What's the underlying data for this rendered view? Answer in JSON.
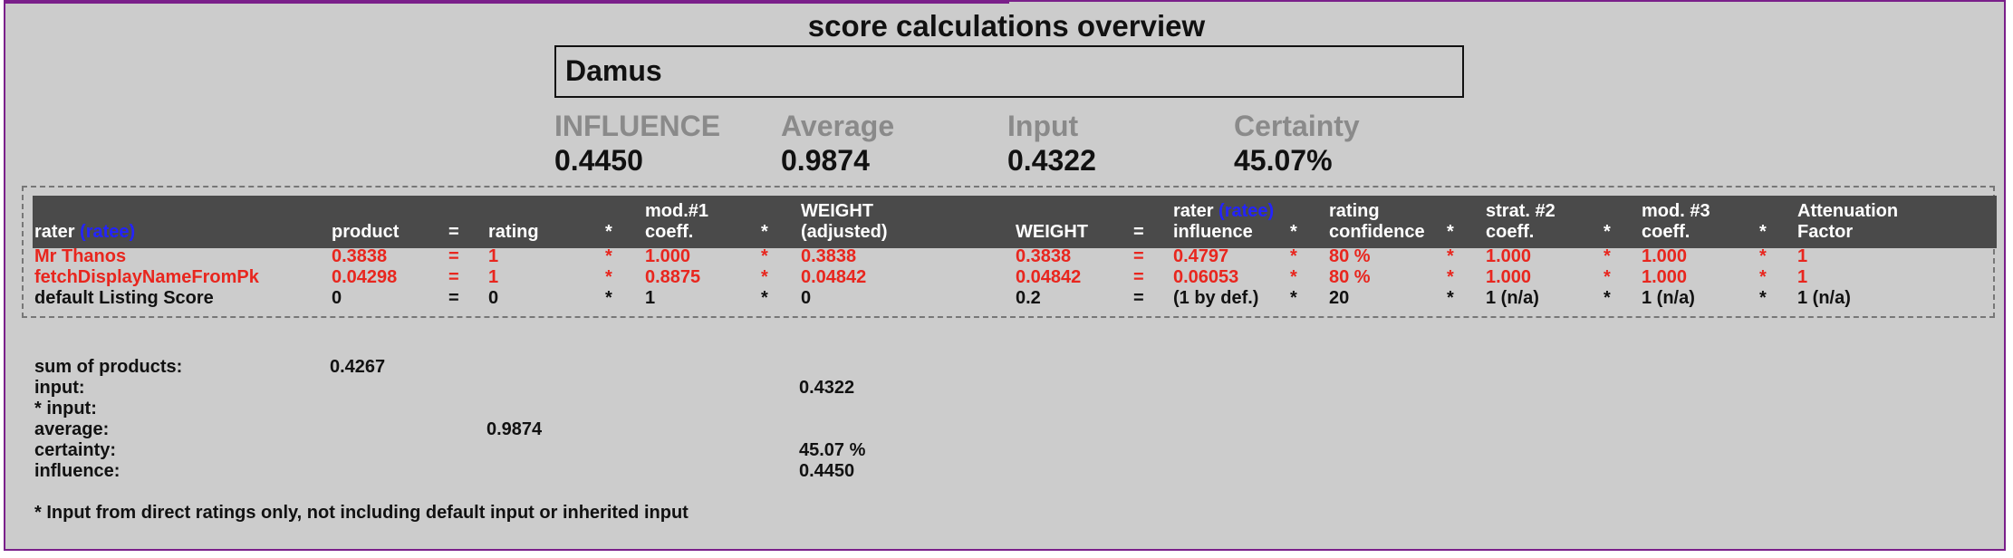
{
  "title": "score calculations overview",
  "ratee_name": "Damus",
  "metrics": [
    {
      "label": "INFLUENCE",
      "value": "0.4450"
    },
    {
      "label": "Average",
      "value": "0.9874"
    },
    {
      "label": "Input",
      "value": "0.4322"
    },
    {
      "label": "Certainty",
      "value": "45.07%"
    }
  ],
  "table": {
    "headers": {
      "rater": "rater",
      "ratee": "(ratee)",
      "product": "product",
      "eq1": "=",
      "rating": "rating",
      "m1": "*",
      "mod1_a": "mod.#1",
      "mod1_b": "coeff.",
      "m2": "*",
      "wadj_a": "WEIGHT",
      "wadj_b": "(adjusted)",
      "weight": "WEIGHT",
      "eq2": "=",
      "ri_a": "rater",
      "ri_ratee": "(ratee)",
      "ri_b": "influence",
      "m3": "*",
      "rc_a": "rating",
      "rc_b": "confidence",
      "m4": "*",
      "s2_a": "strat. #2",
      "s2_b": "coeff.",
      "m5": "*",
      "m3c_a": "mod. #3",
      "m3c_b": "coeff.",
      "m6": "*",
      "att_a": "Attenuation",
      "att_b": "Factor"
    },
    "rows": [
      {
        "rater": "Mr Thanos",
        "product": "0.3838",
        "eq1": "=",
        "rating": "1",
        "m1": "*",
        "mod1": "1.000",
        "m2": "*",
        "wadj": "0.3838",
        "weight": "0.3838",
        "eq2": "=",
        "influence": "0.4797",
        "m3": "*",
        "confidence": "80 %",
        "m4": "*",
        "strat2": "1.000",
        "m5": "*",
        "mod3": "1.000",
        "m6": "*",
        "atten": "1"
      },
      {
        "rater": "fetchDisplayNameFromPk",
        "product": "0.04298",
        "eq1": "=",
        "rating": "1",
        "m1": "*",
        "mod1": "0.8875",
        "m2": "*",
        "wadj": "0.04842",
        "weight": "0.04842",
        "eq2": "=",
        "influence": "0.06053",
        "m3": "*",
        "confidence": "80 %",
        "m4": "*",
        "strat2": "1.000",
        "m5": "*",
        "mod3": "1.000",
        "m6": "*",
        "atten": "1"
      },
      {
        "rater": "default Listing Score",
        "product": "0",
        "eq1": "=",
        "rating": "0",
        "m1": "*",
        "mod1": "1",
        "m2": "*",
        "wadj": "0",
        "weight": "0.2",
        "eq2": "=",
        "influence": "(1 by def.)",
        "m3": "*",
        "confidence": "20",
        "m4": "*",
        "strat2": "1 (n/a)",
        "m5": "*",
        "mod3": "1 (n/a)",
        "m6": "*",
        "atten": "1 (n/a)"
      }
    ]
  },
  "summary": {
    "sum_label": "sum of products:",
    "sum_value": "0.4267",
    "input_label": "input:",
    "input_value": "0.4322",
    "star_input_label": "* input:",
    "average_label": "average:",
    "average_value": "0.9874",
    "certainty_label": "certainty:",
    "certainty_value": "45.07 %",
    "influence_label": "influence:",
    "influence_value": "0.4450",
    "footnote": "* Input from direct ratings only, not including default input or inherited input"
  },
  "colors": {
    "frame": "#7a1f8a",
    "background": "#cccccc",
    "header": "#4a4a4a",
    "highlight_row": "#e8261e",
    "ratee": "#2323ff",
    "metric_label": "#8a8a8a"
  }
}
